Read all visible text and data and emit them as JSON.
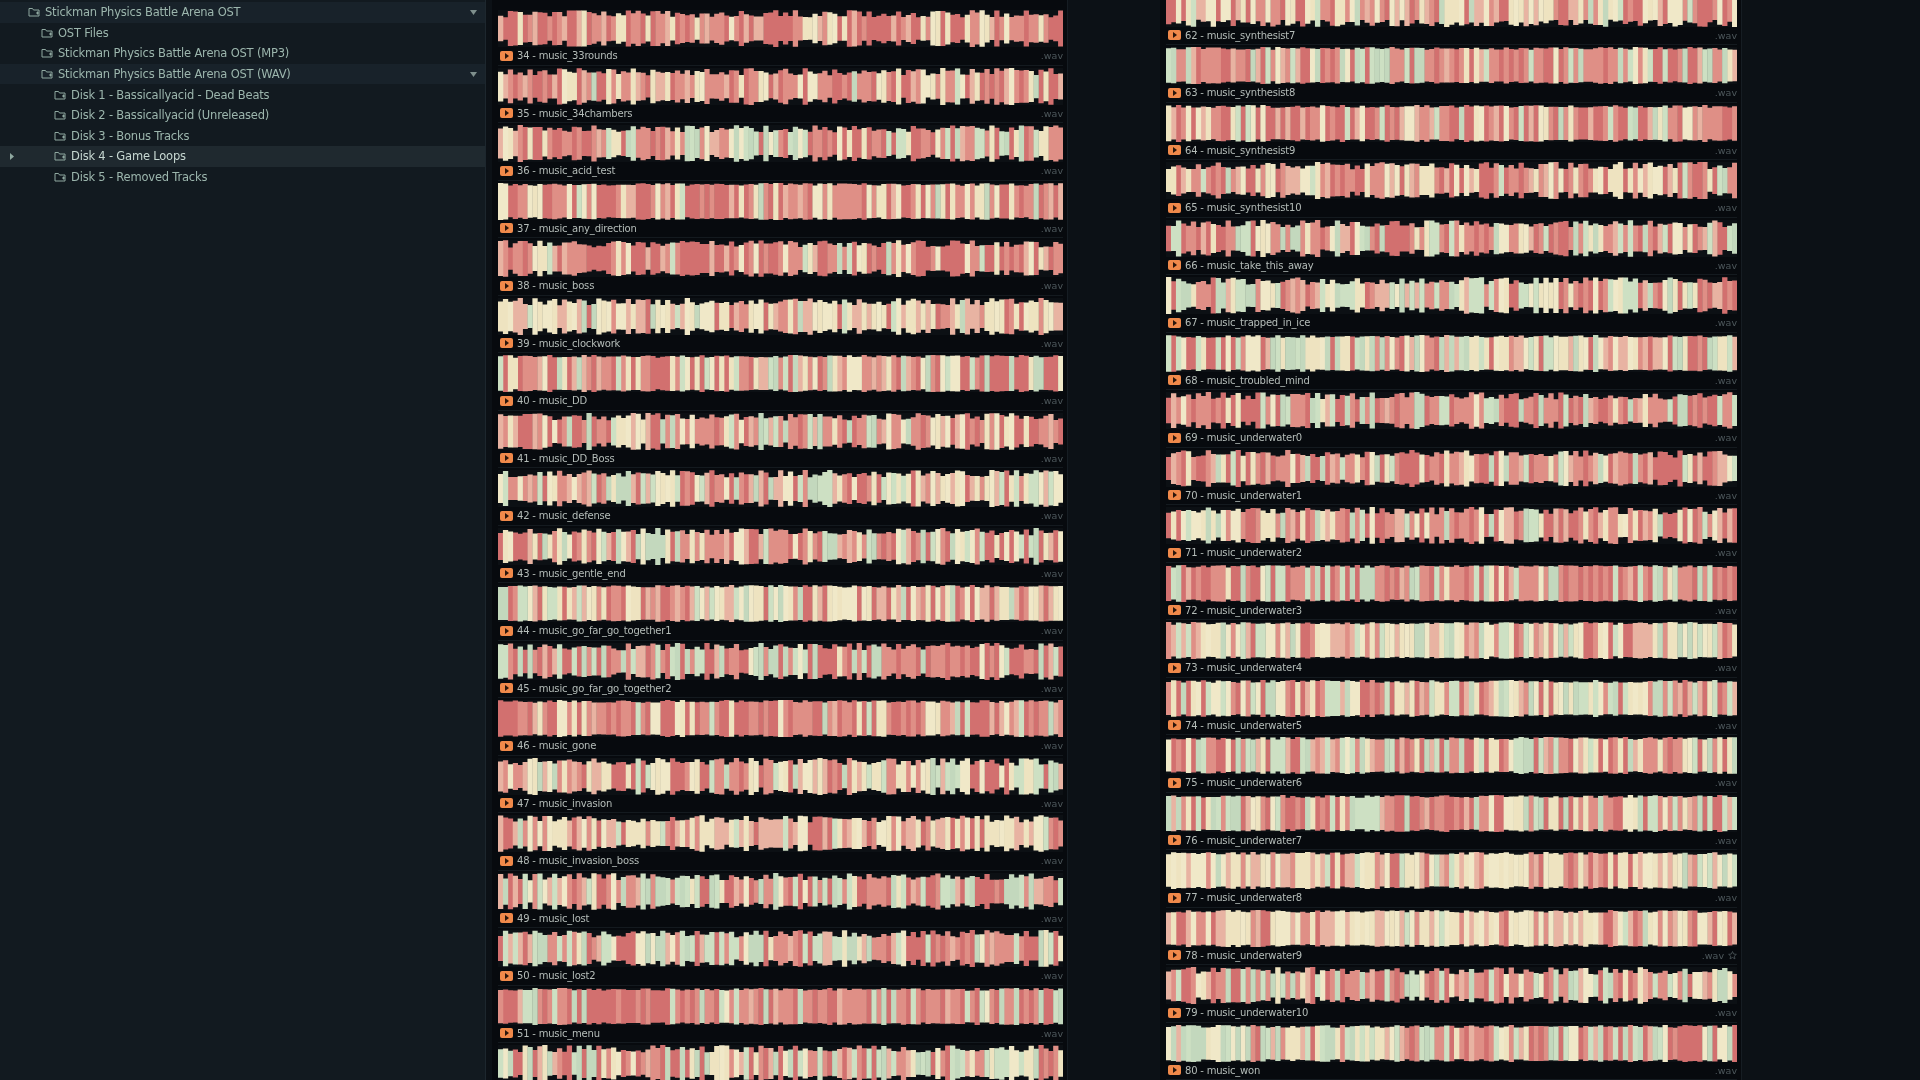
{
  "tree": {
    "items": [
      {
        "label": "Stickman Physics Battle Arena OST",
        "expanded": true,
        "selected": false,
        "children": [
          {
            "label": "OST Files",
            "selected": false
          },
          {
            "label": "Stickman Physics Battle Arena OST (MP3)",
            "selected": false
          },
          {
            "label": "Stickman Physics Battle Arena OST (WAV)",
            "expanded": true,
            "selected": false,
            "children": [
              {
                "label": "Disk 1 - Bassicallyacid - Dead Beats",
                "selected": false
              },
              {
                "label": "Disk 2 - Bassicallyacid (Unreleased)",
                "selected": false
              },
              {
                "label": "Disk 3 - Bonus Tracks",
                "selected": false
              },
              {
                "label": "Disk 4 - Game Loops",
                "selected": true
              },
              {
                "label": "Disk 5 - Removed Tracks",
                "selected": false
              }
            ]
          }
        ]
      }
    ]
  },
  "columns": [
    {
      "items": [
        {
          "kind": "track",
          "name": "34 - music_33rounds",
          "ext": ".wav",
          "starred": false
        },
        {
          "kind": "track",
          "name": "35 - music_34chambers",
          "ext": ".wav",
          "starred": false
        },
        {
          "kind": "track",
          "name": "36 - music_acid_test",
          "ext": ".wav",
          "starred": false
        },
        {
          "kind": "track",
          "name": "37 - music_any_direction",
          "ext": ".wav",
          "starred": false
        },
        {
          "kind": "track",
          "name": "38 - music_boss",
          "ext": ".wav",
          "starred": false
        },
        {
          "kind": "track",
          "name": "39 - music_clockwork",
          "ext": ".wav",
          "starred": false
        },
        {
          "kind": "track",
          "name": "40 - music_DD",
          "ext": ".wav",
          "starred": false
        },
        {
          "kind": "track",
          "name": "41 - music_DD_Boss",
          "ext": ".wav",
          "starred": false
        },
        {
          "kind": "track",
          "name": "42 - music_defense",
          "ext": ".wav",
          "starred": false
        },
        {
          "kind": "track",
          "name": "43 - music_gentle_end",
          "ext": ".wav",
          "starred": false
        },
        {
          "kind": "track",
          "name": "44 - music_go_far_go_together1",
          "ext": ".wav",
          "starred": false
        },
        {
          "kind": "track",
          "name": "45 - music_go_far_go_together2",
          "ext": ".wav",
          "starred": false
        },
        {
          "kind": "track",
          "name": "46 - music_gone",
          "ext": ".wav",
          "starred": false
        },
        {
          "kind": "track",
          "name": "47 - music_invasion",
          "ext": ".wav",
          "starred": false
        },
        {
          "kind": "track",
          "name": "48 - music_invasion_boss",
          "ext": ".wav",
          "starred": false
        },
        {
          "kind": "track",
          "name": "49 - music_lost",
          "ext": ".wav",
          "starred": false
        },
        {
          "kind": "track",
          "name": "50 - music_lost2",
          "ext": ".wav",
          "starred": false
        },
        {
          "kind": "track",
          "name": "51 - music_menu",
          "ext": ".wav",
          "starred": false
        },
        {
          "kind": "wave_only"
        }
      ]
    },
    {
      "items": [
        {
          "kind": "track",
          "name": "62 - music_synthesist7",
          "ext": ".wav",
          "starred": false
        },
        {
          "kind": "track",
          "name": "63 - music_synthesist8",
          "ext": ".wav",
          "starred": false
        },
        {
          "kind": "track",
          "name": "64 - music_synthesist9",
          "ext": ".wav",
          "starred": false
        },
        {
          "kind": "track",
          "name": "65 - music_synthesist10",
          "ext": ".wav",
          "starred": false
        },
        {
          "kind": "track",
          "name": "66 - music_take_this_away",
          "ext": ".wav",
          "starred": false
        },
        {
          "kind": "track",
          "name": "67 - music_trapped_in_ice",
          "ext": ".wav",
          "starred": false
        },
        {
          "kind": "track",
          "name": "68 - music_troubled_mind",
          "ext": ".wav",
          "starred": false
        },
        {
          "kind": "track",
          "name": "69 - music_underwater0",
          "ext": ".wav",
          "starred": false
        },
        {
          "kind": "track",
          "name": "70 - music_underwater1",
          "ext": ".wav",
          "starred": false
        },
        {
          "kind": "track",
          "name": "71 - music_underwater2",
          "ext": ".wav",
          "starred": false
        },
        {
          "kind": "track",
          "name": "72 - music_underwater3",
          "ext": ".wav",
          "starred": false
        },
        {
          "kind": "track",
          "name": "73 - music_underwater4",
          "ext": ".wav",
          "starred": false
        },
        {
          "kind": "track",
          "name": "74 - music_underwater5",
          "ext": ".wav",
          "starred": false
        },
        {
          "kind": "track",
          "name": "75 - music_underwater6",
          "ext": ".wav",
          "starred": false
        },
        {
          "kind": "track",
          "name": "76 - music_underwater7",
          "ext": ".wav",
          "starred": false
        },
        {
          "kind": "track",
          "name": "77 - music_underwater8",
          "ext": ".wav",
          "starred": false
        },
        {
          "kind": "track",
          "name": "78 - music_underwater9",
          "ext": ".wav",
          "starred": true
        },
        {
          "kind": "track",
          "name": "79 - music_underwater10",
          "ext": ".wav",
          "starred": false
        },
        {
          "kind": "track",
          "name": "80 - music_won",
          "ext": ".wav",
          "starred": false
        }
      ]
    }
  ]
}
